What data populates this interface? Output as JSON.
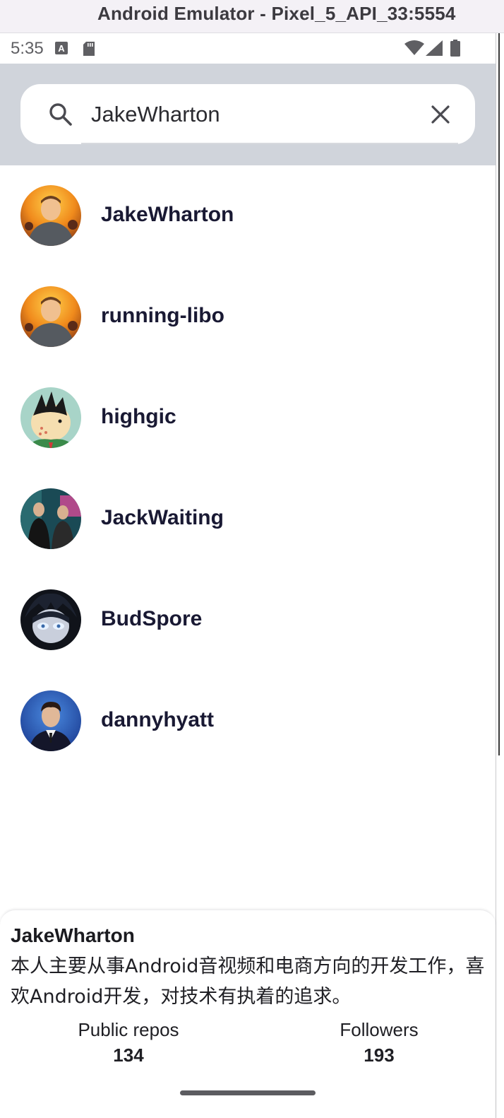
{
  "window": {
    "title": "Android Emulator - Pixel_5_API_33:5554"
  },
  "status_bar": {
    "time": "5:35",
    "icons": [
      "a-notification-icon",
      "sd-card-icon",
      "wifi-icon",
      "cell-signal-icon",
      "battery-icon"
    ]
  },
  "search": {
    "value": "JakeWharton",
    "icon": "search-icon",
    "clear_icon": "close-icon"
  },
  "users": [
    {
      "name": "JakeWharton"
    },
    {
      "name": "running-libo"
    },
    {
      "name": "highgic"
    },
    {
      "name": "JackWaiting"
    },
    {
      "name": "BudSpore"
    },
    {
      "name": "dannyhyatt"
    }
  ],
  "detail": {
    "name": "JakeWharton",
    "bio": "本人主要从事Android音视频和电商方向的开发工作，喜欢Android开发，对技术有执着的追求。",
    "stats": [
      {
        "label": "Public repos",
        "value": "134"
      },
      {
        "label": "Followers",
        "value": "193"
      }
    ]
  },
  "colors": {
    "search_background": "#d0d4db",
    "username_text": "#191933",
    "title_bar": "#f4f1f6"
  }
}
